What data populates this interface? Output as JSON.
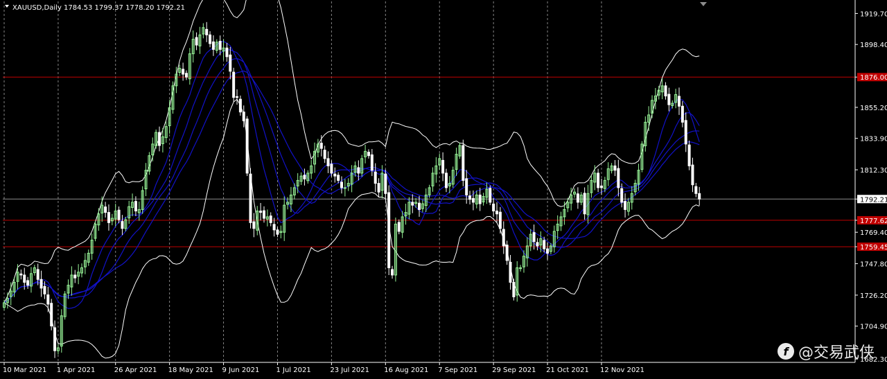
{
  "header": {
    "symbol": "XAUUSD,Daily",
    "ohlc": "1784.53 1799.37 1778.20 1792.21"
  },
  "watermark": {
    "text": "@交易武侠",
    "icon": "weibo-style-logo-icon"
  },
  "colors": {
    "background": "#000000",
    "candle_up": "#98f598",
    "candle_down": "#ffffff",
    "bollinger": "#ffffff",
    "ma": "#1212c8",
    "resistance_line": "#c00000",
    "price_line": "#8c8c8c"
  },
  "chart_data": {
    "type": "candlestick",
    "symbol": "XAUUSD",
    "timeframe": "Daily",
    "ylim": [
      1680,
      1928
    ],
    "y_ticks": [
      1919.7,
      1898.4,
      1876.0,
      1855.2,
      1833.9,
      1812.3,
      1792.21,
      1777.62,
      1769.4,
      1759.45,
      1747.8,
      1726.2,
      1704.9,
      1682.3
    ],
    "y_tick_labels": [
      "1919.70",
      "1898.40",
      "1876.00",
      "1855.20",
      "1833.90",
      "1812.30",
      "1792.21",
      "1777.62",
      "1769.40",
      "1759.45",
      "1747.80",
      "1726.20",
      "1704.90",
      "1682.30"
    ],
    "highlighted_levels": [
      {
        "value": 1876.0,
        "label": "1876.00",
        "color": "#c00000"
      },
      {
        "value": 1777.62,
        "label": "1777.62",
        "color": "#c00000"
      },
      {
        "value": 1759.45,
        "label": "1759.45",
        "color": "#c00000"
      }
    ],
    "current_price": {
      "value": 1792.21,
      "label": "1792.21"
    },
    "x_labels": [
      "10 Mar 2021",
      "1 Apr 2021",
      "26 Apr 2021",
      "18 May 2021",
      "9 Jun 2021",
      "1 Jul 2021",
      "23 Jul 2021",
      "16 Aug 2021",
      "7 Sep 2021",
      "29 Sep 2021",
      "21 Oct 2021",
      "12 Nov 2021"
    ],
    "x_label_index": [
      0,
      16,
      33,
      49,
      65,
      81,
      97,
      113,
      129,
      145,
      161,
      177
    ],
    "closes": [
      1721,
      1724,
      1729,
      1735,
      1742,
      1740,
      1735,
      1733,
      1741,
      1745,
      1737,
      1731,
      1727,
      1720,
      1705,
      1688,
      1690,
      1712,
      1727,
      1733,
      1740,
      1738,
      1742,
      1745,
      1750,
      1755,
      1764,
      1775,
      1782,
      1788,
      1783,
      1776,
      1779,
      1784,
      1778,
      1772,
      1778,
      1787,
      1790,
      1784,
      1785,
      1798,
      1812,
      1822,
      1830,
      1838,
      1829,
      1835,
      1842,
      1855,
      1870,
      1878,
      1882,
      1878,
      1876,
      1892,
      1902,
      1898,
      1905,
      1910,
      1905,
      1899,
      1895,
      1900,
      1895,
      1896,
      1890,
      1880,
      1862,
      1862,
      1852,
      1846,
      1810,
      1776,
      1772,
      1784,
      1783,
      1779,
      1780,
      1776,
      1771,
      1768,
      1770,
      1788,
      1790,
      1795,
      1800,
      1805,
      1808,
      1806,
      1810,
      1815,
      1825,
      1830,
      1827,
      1820,
      1815,
      1810,
      1808,
      1805,
      1800,
      1800,
      1803,
      1810,
      1815,
      1810,
      1820,
      1825,
      1822,
      1812,
      1803,
      1797,
      1810,
      1796,
      1745,
      1740,
      1775,
      1770,
      1780,
      1783,
      1790,
      1788,
      1790,
      1785,
      1789,
      1795,
      1800,
      1810,
      1815,
      1820,
      1810,
      1800,
      1803,
      1812,
      1823,
      1829,
      1805,
      1795,
      1792,
      1790,
      1795,
      1789,
      1794,
      1799,
      1790,
      1784,
      1782,
      1772,
      1760,
      1750,
      1735,
      1725,
      1745,
      1745,
      1753,
      1760,
      1768,
      1763,
      1760,
      1765,
      1758,
      1755,
      1760,
      1770,
      1775,
      1780,
      1785,
      1790,
      1795,
      1797,
      1790,
      1795,
      1782,
      1796,
      1805,
      1810,
      1800,
      1800,
      1805,
      1813,
      1815,
      1812,
      1800,
      1790,
      1785,
      1790,
      1796,
      1803,
      1812,
      1830,
      1845,
      1850,
      1860,
      1863,
      1867,
      1870,
      1863,
      1857,
      1858,
      1864,
      1856,
      1845,
      1830,
      1815,
      1802,
      1796,
      1792.21
    ],
    "indicators": [
      "Bollinger Bands",
      "Moving Averages"
    ],
    "grid": true
  }
}
